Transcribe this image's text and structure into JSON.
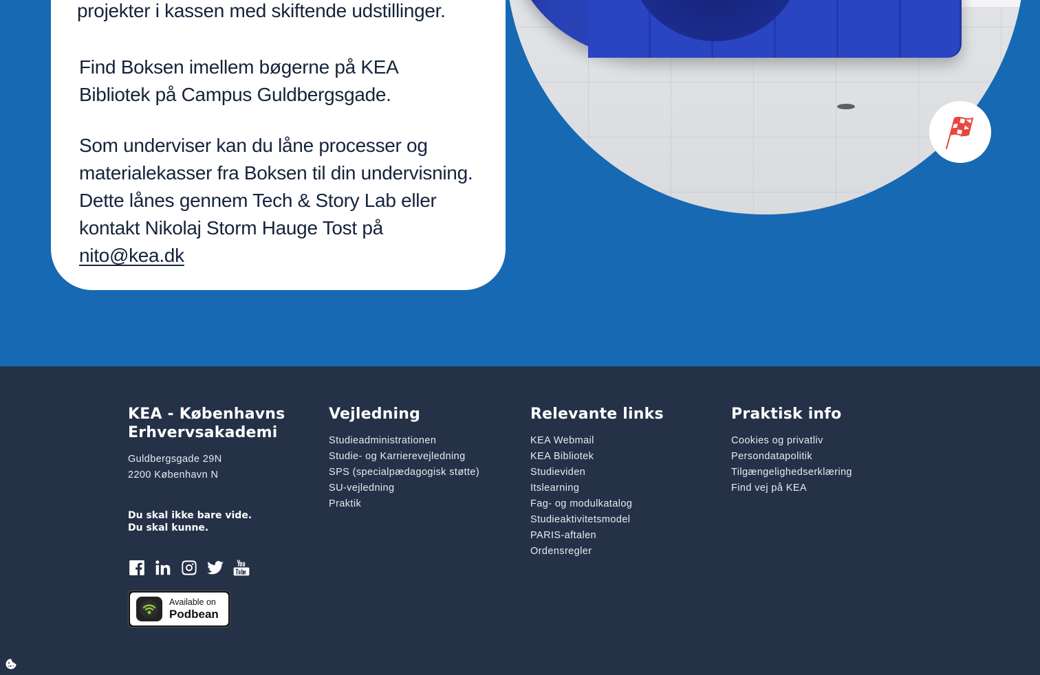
{
  "card": {
    "paragraph1": "naturen bygger og se andre studerendes projekter i kassen med skiftende udstillinger.",
    "paragraph2": "Find Boksen imellem bøgerne på KEA Bibliotek på Campus Guldbergsgade.",
    "paragraph3": "Som underviser kan du låne processer og materialekasser fra Boksen til din undervisning. Dette lånes gennem Tech & Story Lab eller kontakt Nikolaj Storm Hauge Tost på",
    "email": "nito@kea.dk"
  },
  "photo": {
    "badge_icon": "checkered-flag-icon",
    "accent_color": "#e8453c"
  },
  "footer": {
    "org": {
      "title": "KEA - Københavns Erhvervsakademi",
      "address_line1": "Guldbergsgade 29N",
      "address_line2": "2200 København N",
      "slogan_line1": "Du skal ikke bare vide.",
      "slogan_line2": "Du skal kunne."
    },
    "vejledning": {
      "title": "Vejledning",
      "links": [
        "Studieadministrationen",
        "Studie- og Karrierevejledning",
        "SPS (specialpædagogisk støtte)",
        "SU-vejledning",
        "Praktik"
      ]
    },
    "relevante": {
      "title": "Relevante links",
      "links": [
        "KEA Webmail",
        "KEA Bibliotek",
        "Studieviden",
        "Itslearning",
        "Fag- og modulkatalog",
        "Studieaktivitetsmodel",
        "PARIS-aftalen",
        "Ordensregler"
      ]
    },
    "praktisk": {
      "title": "Praktisk info",
      "links": [
        "Cookies og privatliv",
        "Persondatapolitik",
        "Tilgængelighedserklæring",
        "Find vej på KEA"
      ]
    },
    "social": [
      "facebook-icon",
      "linkedin-icon",
      "instagram-icon",
      "twitter-icon",
      "youtube-icon"
    ],
    "podbean": {
      "small": "Available on",
      "big": "Podbean"
    }
  },
  "colors": {
    "hero_bg": "#1769b3",
    "footer_bg": "#243147",
    "text_dark": "#15233b"
  }
}
